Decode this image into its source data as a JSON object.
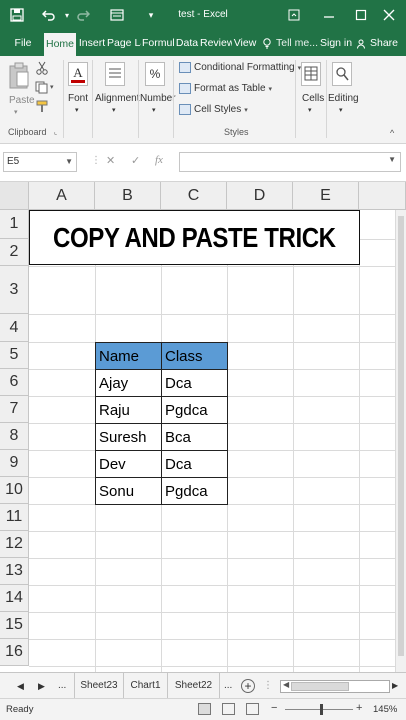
{
  "window": {
    "title": "test - Excel",
    "quick_access": [
      "save-icon",
      "undo-icon",
      "redo-icon",
      "form-icon",
      "customize-icon"
    ],
    "controls": [
      "ribbon-display-icon",
      "minimize-icon",
      "maximize-icon",
      "close-icon"
    ]
  },
  "ribbon_tabs": {
    "file": "File",
    "home": "Home",
    "insert": "Insert",
    "page_layout": "Page La",
    "formulas": "Formul",
    "data": "Data",
    "review": "Review",
    "view": "View",
    "tell_me": "Tell me...",
    "sign_in": "Sign in",
    "share": "Share"
  },
  "ribbon": {
    "clipboard": {
      "paste": "Paste",
      "group": "Clipboard"
    },
    "font": "Font",
    "alignment": "Alignment",
    "number": "Number",
    "styles": {
      "conditional": "Conditional Formatting",
      "format_table": "Format as Table",
      "cell_styles": "Cell Styles",
      "group": "Styles"
    },
    "cells": "Cells",
    "editing": "Editing"
  },
  "formula_bar": {
    "name_box": "E5",
    "fx": "fx",
    "formula": ""
  },
  "grid": {
    "columns": [
      "A",
      "B",
      "C",
      "D",
      "E"
    ],
    "rows": [
      "1",
      "2",
      "3",
      "4",
      "5",
      "6",
      "7",
      "8",
      "9",
      "10",
      "11",
      "12",
      "13",
      "14",
      "15",
      "16"
    ],
    "banner": "COPY AND PASTE TRICK",
    "table_header": {
      "name": "Name",
      "class": "Class"
    },
    "table_rows": [
      {
        "name": "Ajay",
        "class": "Dca"
      },
      {
        "name": "Raju",
        "class": "Pgdca"
      },
      {
        "name": "Suresh",
        "class": "Bca"
      },
      {
        "name": "Dev",
        "class": "Dca"
      },
      {
        "name": "Sonu",
        "class": "Pgdca"
      }
    ],
    "header_color": "#5b9bd5"
  },
  "sheets": {
    "ellipsis_left": "...",
    "tabs": [
      "Sheet23",
      "Chart1",
      "Sheet22"
    ],
    "ellipsis_right": "..."
  },
  "status": {
    "ready": "Ready",
    "zoom": "145%"
  },
  "colors": {
    "excel_green": "#217346",
    "header_fill": "#5b9bd5"
  }
}
